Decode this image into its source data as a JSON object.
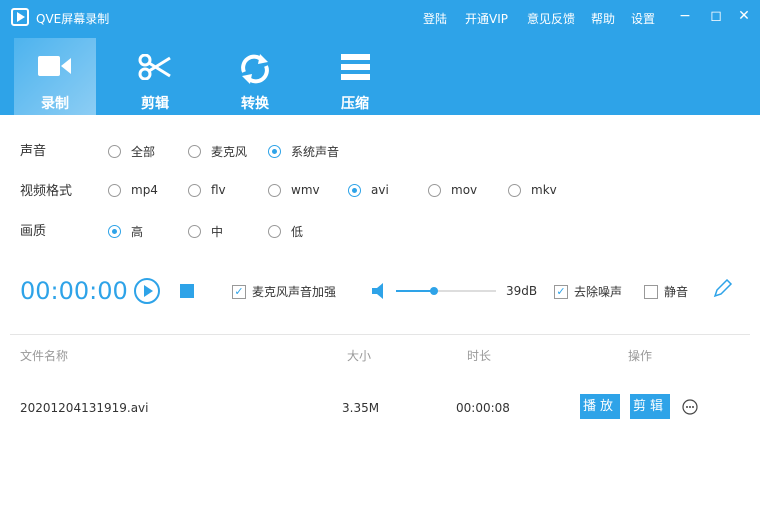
{
  "window": {
    "title": "QVE屏幕录制",
    "menu": [
      "登陆",
      "开通VIP",
      "意见反馈",
      "帮助",
      "设置"
    ]
  },
  "tabs": [
    {
      "label": "录制",
      "icon": "video-camera-icon"
    },
    {
      "label": "剪辑",
      "icon": "scissors-icon"
    },
    {
      "label": "转换",
      "icon": "refresh-icon"
    },
    {
      "label": "压缩",
      "icon": "compress-icon"
    }
  ],
  "settings": {
    "sound": {
      "label": "声音",
      "options": [
        "全部",
        "麦克风",
        "系统声音"
      ],
      "selected": "系统声音"
    },
    "format": {
      "label": "视频格式",
      "options": [
        "mp4",
        "flv",
        "wmv",
        "avi",
        "mov",
        "mkv"
      ],
      "selected": "avi"
    },
    "quality": {
      "label": "画质",
      "options": [
        "高",
        "中",
        "低"
      ],
      "selected": "高"
    }
  },
  "controls": {
    "timer": "00:00:00",
    "mic_boost": "麦克风声音加强",
    "mic_boost_checked": true,
    "volume": "39dB",
    "volume_fraction": 0.38,
    "denoise": "去除噪声",
    "denoise_checked": true,
    "mute": "静音",
    "mute_checked": false
  },
  "table": {
    "headers": [
      "文件名称",
      "大小",
      "时长",
      "操作"
    ],
    "rows": [
      {
        "name": "20201204131919.avi",
        "size": "3.35M",
        "duration": "00:00:08",
        "play": "播放",
        "edit": "剪辑"
      }
    ]
  },
  "colors": {
    "accent": "#2ea3e8"
  }
}
